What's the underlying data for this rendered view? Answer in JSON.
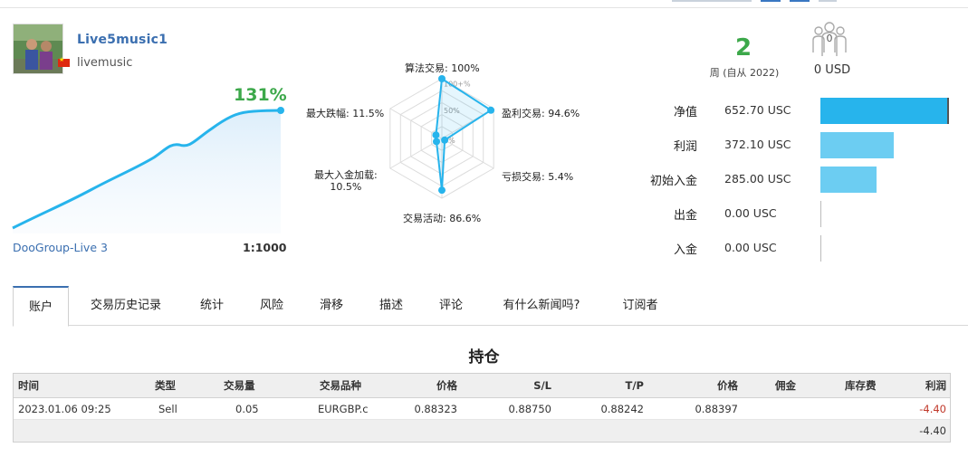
{
  "profile": {
    "name": "Live5music1",
    "login": "livemusic",
    "country_flag_icon": "flag-cn-icon"
  },
  "growth": {
    "value": "131%",
    "server": "DooGroup-Live 3",
    "leverage": "1:1000",
    "line_color": "#27b4ec",
    "value_color": "#3ca84a"
  },
  "radar": {
    "ring_labels": [
      "100+%",
      "50%",
      "0%"
    ],
    "axes": [
      {
        "label": "算法交易: 100%",
        "value": 100
      },
      {
        "label": "盈利交易: 94.6%",
        "value": 94.6
      },
      {
        "label": "亏损交易: 5.4%",
        "value": 5.4
      },
      {
        "label": "交易活动: 86.6%",
        "value": 86.6
      },
      {
        "label_line1": "最大入金加载:",
        "label_line2": "10.5%",
        "value": 10.5
      },
      {
        "label": "最大跌幅: 11.5%",
        "value": 11.5
      }
    ]
  },
  "weeks": {
    "value": "2",
    "label": "周 (自从 2022)"
  },
  "subscribers": {
    "count": "0",
    "value": "0 USD",
    "icon": "subscribers-icon"
  },
  "finance": [
    {
      "label": "净值",
      "value": "652.70 USC",
      "fraction": 1.0
    },
    {
      "label": "利润",
      "value": "372.10 USC",
      "fraction": 0.57
    },
    {
      "label": "初始入金",
      "value": "285.00 USC",
      "fraction": 0.437
    },
    {
      "label": "出金",
      "value": "0.00 USC",
      "fraction": 0
    },
    {
      "label": "入金",
      "value": "0.00 USC",
      "fraction": 0
    }
  ],
  "tabs": [
    {
      "label": "账户",
      "active": true
    },
    {
      "label": "交易历史记录"
    },
    {
      "label": "统计"
    },
    {
      "label": "风险"
    },
    {
      "label": "滑移"
    },
    {
      "label": "描述"
    },
    {
      "label": "评论"
    },
    {
      "label": "有什么新闻吗?"
    },
    {
      "label": "订阅者"
    }
  ],
  "positions": {
    "title": "持仓",
    "headers": [
      "时间",
      "类型",
      "交易量",
      "交易品种",
      "价格",
      "S/L",
      "T/P",
      "价格",
      "佣金",
      "库存费",
      "利润"
    ],
    "rows": [
      [
        "2023.01.06 09:25",
        "Sell",
        "0.05",
        "EURGBP.c",
        "0.88323",
        "0.88750",
        "0.88242",
        "0.88397",
        "",
        "",
        "-4.40"
      ]
    ],
    "total_profit": "-4.40"
  },
  "colors": {
    "accent_blue": "#3b6fb0",
    "bar_primary": "#27b4ec",
    "bar_secondary": "#6ccdf2",
    "green": "#3ca84a",
    "negative": "#c0392b"
  }
}
